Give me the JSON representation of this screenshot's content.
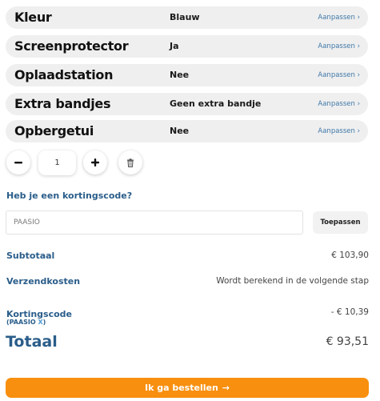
{
  "options": [
    {
      "label": "Kleur",
      "value": "Blauw",
      "edit": "Aanpassen ›"
    },
    {
      "label": "Screenprotector",
      "value": "Ja",
      "edit": "Aanpassen ›"
    },
    {
      "label": "Oplaadstation",
      "value": "Nee",
      "edit": "Aanpassen ›"
    },
    {
      "label": "Extra bandjes",
      "value": "Geen extra bandje",
      "edit": "Aanpassen ›"
    },
    {
      "label": "Opbergetui",
      "value": "Nee",
      "edit": "Aanpassen ›"
    }
  ],
  "quantity": {
    "value": "1",
    "decrease_icon": "minus-icon",
    "increase_icon": "plus-icon",
    "delete_icon": "trash-icon"
  },
  "coupon": {
    "question": "Heb je een kortingscode?",
    "input_value": "PAASIO",
    "apply_label": "Toepassen"
  },
  "summary": {
    "subtotal_label": "Subtotaal",
    "subtotal_value": "€ 103,90",
    "shipping_label": "Verzendkosten",
    "shipping_value": "Wordt berekend in de volgende stap",
    "discount_label": "Kortingscode",
    "discount_code_prefix": "(PAASIO ",
    "discount_code_remove": "X",
    "discount_code_suffix": ")",
    "discount_value": "- € 10,39",
    "total_label": "Totaal",
    "total_value": "€ 93,51"
  },
  "order_button": {
    "label": "Ik ga bestellen",
    "arrow": "→"
  },
  "colors": {
    "accent_blue": "#2a5d8a",
    "link_blue": "#3f78a8",
    "order_orange": "#f88f0f",
    "row_bg": "#efefef"
  }
}
